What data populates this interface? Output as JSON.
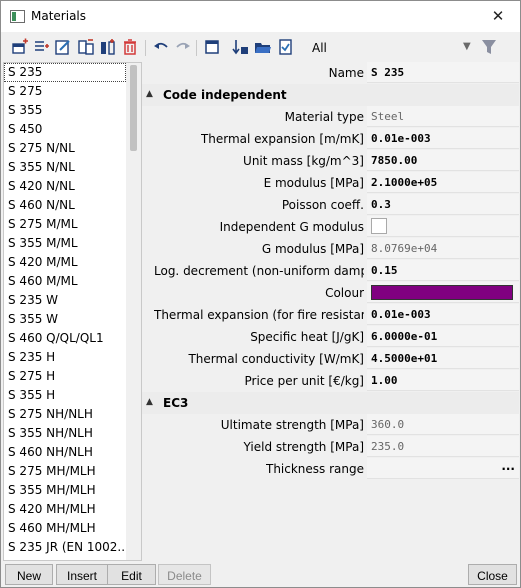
{
  "window": {
    "title": "Materials"
  },
  "toolbar": {
    "filter_value": "All",
    "icons": [
      "new-material-icon",
      "insert-icon",
      "edit-icon",
      "copy-icon",
      "import-icon",
      "delete-icon",
      "undo-icon",
      "redo-icon",
      "library-icon",
      "sort-icon",
      "open-folder-icon",
      "check-icon",
      "filter-icon"
    ]
  },
  "materials": [
    "S 235",
    "S 275",
    "S 355",
    "S 450",
    "S 275 N/NL",
    "S 355 N/NL",
    "S 420 N/NL",
    "S 460 N/NL",
    "S 275 M/ML",
    "S 355 M/ML",
    "S 420 M/ML",
    "S 460 M/ML",
    "S 235 W",
    "S 355 W",
    "S 460 Q/QL/QL1",
    "S 235 H",
    "S 275 H",
    "S 355 H",
    "S 275 NH/NLH",
    "S 355 NH/NLH",
    "S 460 NH/NLH",
    "S 275 MH/MLH",
    "S 355 MH/MLH",
    "S 420 MH/MLH",
    "S 460 MH/MLH",
    "S 235 JR (EN 1002..."
  ],
  "selected_material": "S 235",
  "properties": {
    "name_label": "Name",
    "name_value": "S 235",
    "section1_title": "Code independent",
    "rows1": [
      {
        "label": "Material type",
        "value": "Steel",
        "style": "gray"
      },
      {
        "label": "Thermal expansion  [m/mK]",
        "value": "0.01e-003",
        "style": "bold"
      },
      {
        "label": "Unit mass [kg/m^3]",
        "value": "7850.00",
        "style": "bold"
      },
      {
        "label": "E modulus [MPa]",
        "value": "2.1000e+05",
        "style": "bold"
      },
      {
        "label": "Poisson coeff.",
        "value": "0.3",
        "style": "bold"
      },
      {
        "label": "Independent G modulus",
        "value": "",
        "style": "checkbox"
      },
      {
        "label": "G modulus [MPa]",
        "value": "8.0769e+04",
        "style": "gray"
      },
      {
        "label": "Log. decrement (non-uniform dampin",
        "value": "0.15",
        "style": "bold"
      },
      {
        "label": "Colour",
        "value": "",
        "style": "color"
      },
      {
        "label": "Thermal expansion (for fire resistance",
        "value": "0.01e-003",
        "style": "bold"
      },
      {
        "label": "Specific heat [J/gK]",
        "value": "6.0000e-01",
        "style": "bold"
      },
      {
        "label": "Thermal conductivity [W/mK]",
        "value": "4.5000e+01",
        "style": "bold"
      },
      {
        "label": "Price per unit [€/kg]",
        "value": "1.00",
        "style": "bold"
      }
    ],
    "section2_title": "EC3",
    "rows2": [
      {
        "label": "Ultimate strength [MPa]",
        "value": "360.0",
        "style": "gray"
      },
      {
        "label": "Yield strength [MPa]",
        "value": "235.0",
        "style": "gray"
      },
      {
        "label": "Thickness range",
        "value": "...",
        "style": "ellipsis"
      }
    ],
    "colour_hex": "#800080"
  },
  "buttons": {
    "new": "New",
    "insert": "Insert",
    "edit": "Edit",
    "delete": "Delete",
    "close": "Close"
  }
}
